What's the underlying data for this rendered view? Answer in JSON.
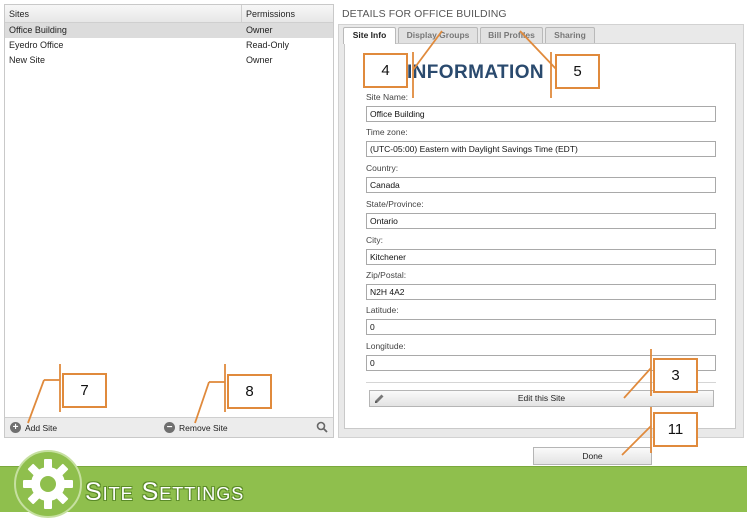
{
  "sites_table": {
    "col_sites": "Sites",
    "col_permissions": "Permissions",
    "rows": [
      {
        "site": "Office Building",
        "permission": "Owner",
        "selected": true
      },
      {
        "site": "Eyedro Office",
        "permission": "Read-Only",
        "selected": false
      },
      {
        "site": "New Site",
        "permission": "Owner",
        "selected": false
      }
    ],
    "add_label": "Add Site",
    "remove_label": "Remove Site"
  },
  "details": {
    "title": "DETAILS FOR OFFICE BUILDING",
    "tabs": [
      "Site Info",
      "Display Groups",
      "Bill Profiles",
      "Sharing"
    ],
    "active_tab": "Site Info",
    "heading": "INFORMATION",
    "fields": {
      "site_name": {
        "label": "Site Name:",
        "value": "Office Building"
      },
      "time_zone": {
        "label": "Time zone:",
        "value": "(UTC-05:00) Eastern with Daylight Savings Time (EDT)"
      },
      "country": {
        "label": "Country:",
        "value": "Canada"
      },
      "state": {
        "label": "State/Province:",
        "value": "Ontario"
      },
      "city": {
        "label": "City:",
        "value": "Kitchener"
      },
      "zip": {
        "label": "Zip/Postal:",
        "value": "N2H 4A2"
      },
      "latitude": {
        "label": "Latitude:",
        "value": "0"
      },
      "longitude": {
        "label": "Longitude:",
        "value": "0"
      }
    },
    "edit_button": "Edit this Site",
    "done_button": "Done"
  },
  "callouts": {
    "c4": "4",
    "c5": "5",
    "c3": "3",
    "c11": "11",
    "c7": "7",
    "c8": "8"
  },
  "banner": {
    "title": "Site Settings",
    "icon": "gear-icon"
  },
  "colors": {
    "banner_green": "#8fbf4d",
    "callout_orange": "#e08a3c",
    "heading_blue": "#2a4a6e"
  }
}
